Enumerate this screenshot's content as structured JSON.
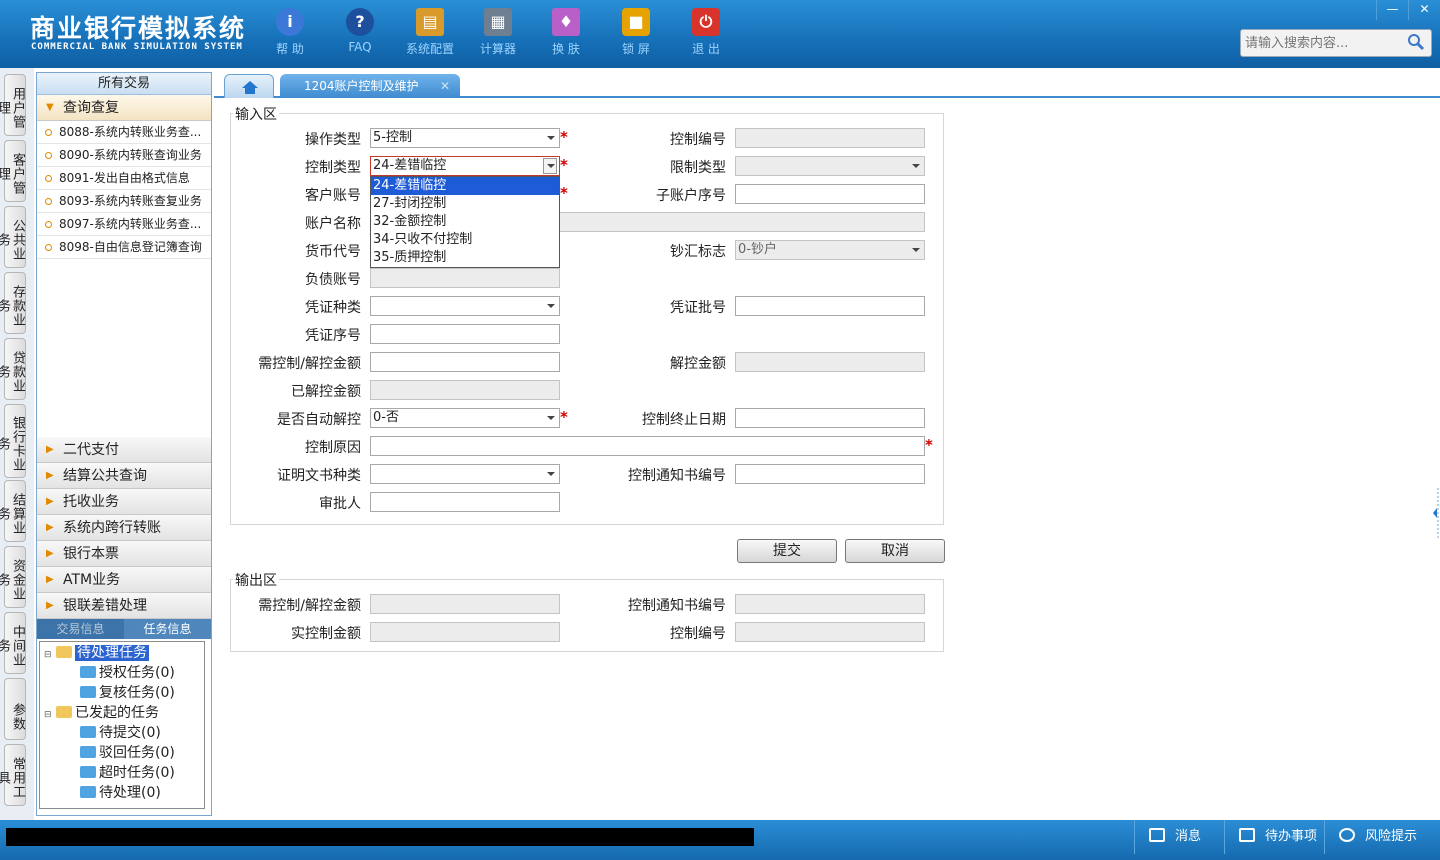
{
  "header": {
    "title": "商业银行模拟系统",
    "subtitle": "COMMERCIAL BANK SIMULATION SYSTEM",
    "tools": [
      {
        "label": "帮 助",
        "icon": "help-icon",
        "color": "#3b78d8"
      },
      {
        "label": "FAQ",
        "icon": "faq-icon",
        "color": "#1d4f9c"
      },
      {
        "label": "系统配置",
        "icon": "toolbox-icon",
        "color": "#d89a2a"
      },
      {
        "label": "计算器",
        "icon": "calculator-icon",
        "color": "#6d7f90"
      },
      {
        "label": "换 肤",
        "icon": "shirt-icon",
        "color": "#b85fc8"
      },
      {
        "label": "锁 屏",
        "icon": "lock-icon",
        "color": "#e5a200"
      },
      {
        "label": "退 出",
        "icon": "power-icon",
        "color": "#d9342b"
      }
    ],
    "window_controls": {
      "minimize": "—",
      "close": "✕"
    },
    "search": {
      "placeholder": "请输入搜索内容..."
    }
  },
  "vertical_tabs": [
    "用户管理",
    "客户管理",
    "公共业务",
    "存款业务",
    "贷款业务",
    "银行卡业务",
    "结算业务",
    "资金业务",
    "中间业务",
    "参数",
    "常用工具"
  ],
  "sidebar": {
    "title": "所有交易",
    "open_group": "查询查复",
    "transactions": [
      "8088-系统内转账业务查...",
      "8090-系统内转账查询业务",
      "8091-发出自由格式信息",
      "8093-系统内转账查复业务",
      "8097-系统内转账业务查...",
      "8098-自由信息登记簿查询"
    ],
    "groups": [
      "二代支付",
      "结算公共查询",
      "托收业务",
      "系统内跨行转账",
      "银行本票",
      "ATM业务",
      "银联差错处理"
    ],
    "info_tabs": {
      "transaction_info": "交易信息",
      "task_info": "任务信息"
    },
    "task_tree": {
      "pending": "待处理任务",
      "authorize": "授权任务(0)",
      "review": "复核任务(0)",
      "initiated": "已发起的任务",
      "to_submit": "待提交(0)",
      "rejected": "驳回任务(0)",
      "timeout": "超时任务(0)",
      "to_process": "待处理(0)"
    }
  },
  "tabs": {
    "active": "1204账户控制及维护",
    "close": "✕"
  },
  "input_area": {
    "legend": "输入区",
    "fields": {
      "op_type": {
        "label": "操作类型",
        "value": "5-控制"
      },
      "control_no": {
        "label": "控制编号",
        "value": ""
      },
      "control_type": {
        "label": "控制类型",
        "value": "24-差错临控"
      },
      "limit_type": {
        "label": "限制类型",
        "value": ""
      },
      "customer_account": {
        "label": "客户账号",
        "value": ""
      },
      "sub_account_no": {
        "label": "子账户序号",
        "value": ""
      },
      "account_name": {
        "label": "账户名称",
        "value": ""
      },
      "currency_code": {
        "label": "货币代号",
        "value": ""
      },
      "cash_flag": {
        "label": "钞汇标志",
        "value": "0-钞户"
      },
      "liability_account": {
        "label": "负债账号",
        "value": ""
      },
      "voucher_type": {
        "label": "凭证种类",
        "value": ""
      },
      "voucher_batch": {
        "label": "凭证批号",
        "value": ""
      },
      "voucher_seq": {
        "label": "凭证序号",
        "value": ""
      },
      "control_amount": {
        "label": "需控制/解控金额",
        "value": ""
      },
      "release_amount": {
        "label": "解控金额",
        "value": ""
      },
      "released_amount": {
        "label": "已解控金额",
        "value": ""
      },
      "auto_release": {
        "label": "是否自动解控",
        "value": "0-否"
      },
      "control_end_date": {
        "label": "控制终止日期",
        "value": ""
      },
      "control_reason": {
        "label": "控制原因",
        "value": ""
      },
      "doc_type": {
        "label": "证明文书种类",
        "value": ""
      },
      "notice_no": {
        "label": "控制通知书编号",
        "value": ""
      },
      "approver": {
        "label": "审批人",
        "value": ""
      }
    },
    "required_mark": "*",
    "dropdown_options": [
      "24-差错临控",
      "27-封闭控制",
      "32-金额控制",
      "34-只收不付控制",
      "35-质押控制"
    ]
  },
  "buttons": {
    "submit": "提交",
    "cancel": "取消"
  },
  "output_area": {
    "legend": "输出区",
    "fields": {
      "control_amount": {
        "label": "需控制/解控金额",
        "value": ""
      },
      "notice_no": {
        "label": "控制通知书编号",
        "value": ""
      },
      "actual_amount": {
        "label": "实控制金额",
        "value": ""
      },
      "control_no": {
        "label": "控制编号",
        "value": ""
      }
    }
  },
  "statusbar": {
    "message": "消息",
    "todo": "待办事项",
    "risk": "风险提示"
  }
}
